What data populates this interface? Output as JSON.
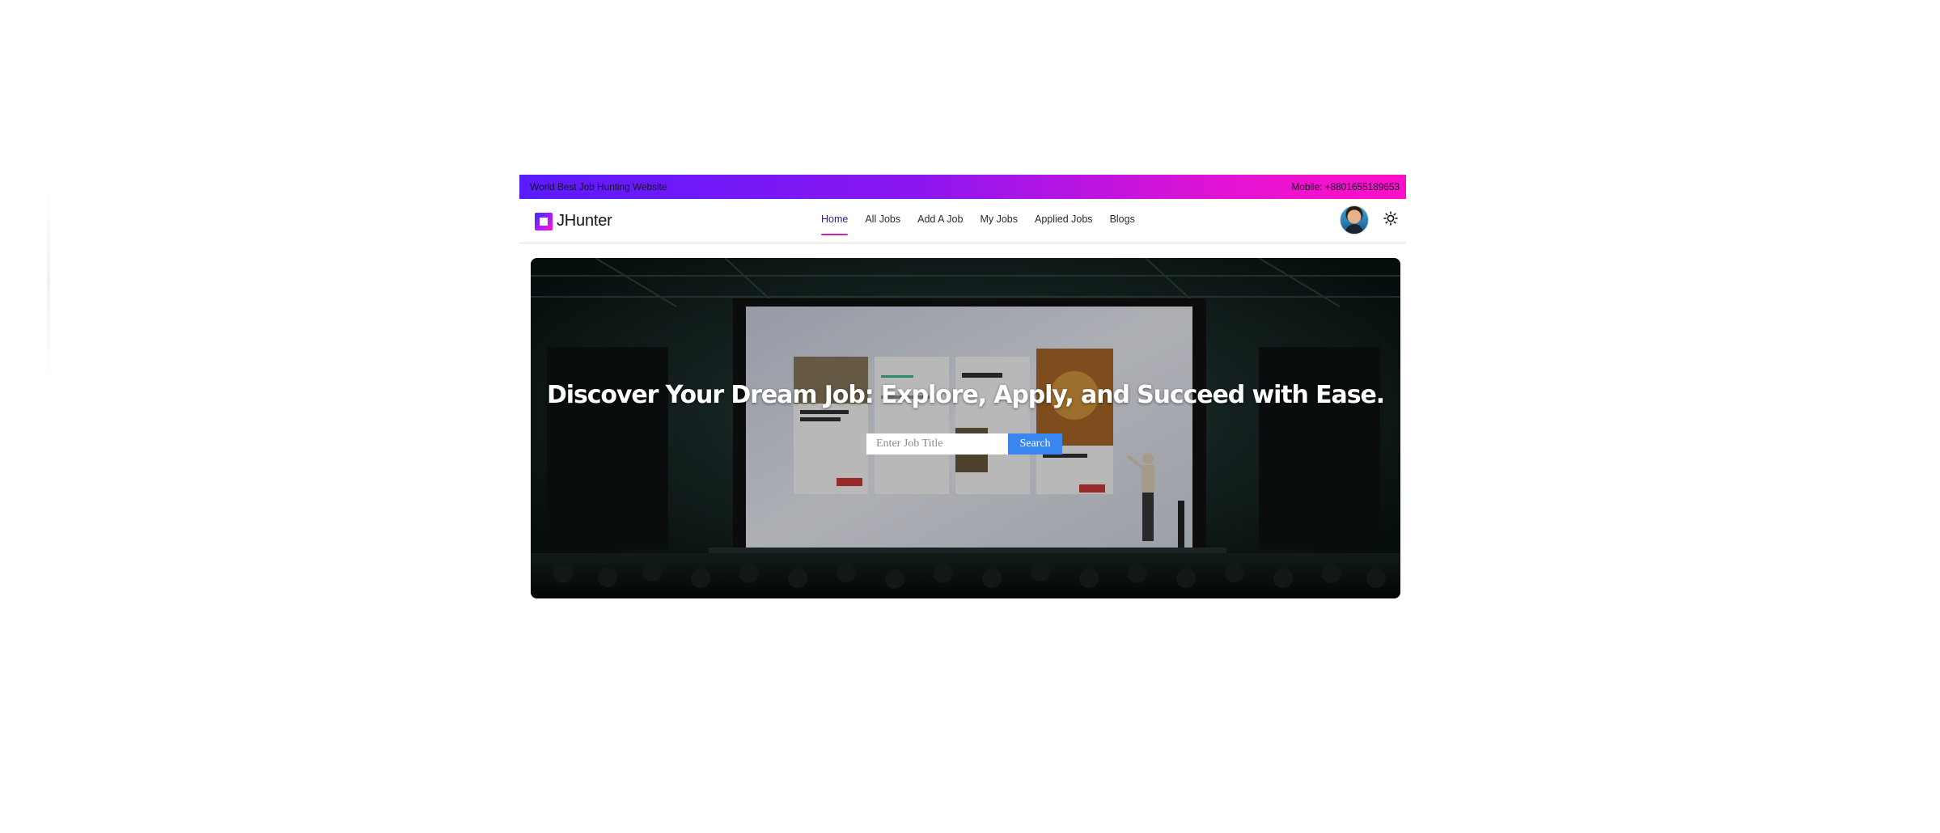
{
  "topbar": {
    "tagline": "World Best Job Hunting Website",
    "mobile": "Mobile: +8801655189653"
  },
  "brand": {
    "name": "JHunter",
    "logo_icon": "square-logo-icon"
  },
  "nav": {
    "items": [
      {
        "label": "Home",
        "active": true
      },
      {
        "label": "All Jobs",
        "active": false
      },
      {
        "label": "Add A Job",
        "active": false
      },
      {
        "label": "My Jobs",
        "active": false
      },
      {
        "label": "Applied Jobs",
        "active": false
      },
      {
        "label": "Blogs",
        "active": false
      }
    ]
  },
  "header_icons": {
    "avatar": "user-avatar",
    "theme_toggle": "sun-icon"
  },
  "hero": {
    "title": "Discover Your Dream Job: Explore, Apply, and Succeed with Ease.",
    "search_placeholder": "Enter Job Title",
    "search_value": "",
    "search_button": "Search"
  },
  "colors": {
    "topbar_gradient_start": "#5a1bff",
    "topbar_gradient_end": "#ff0fc8",
    "active_underline": "#d321b7",
    "search_button": "#3a86f0"
  }
}
